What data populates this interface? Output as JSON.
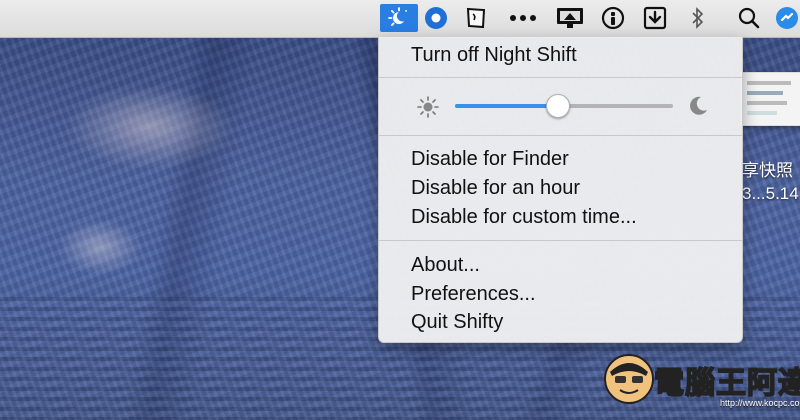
{
  "menubar": {
    "icons": [
      "shifty-icon",
      "blue-circle-icon",
      "script-icon",
      "more-icon",
      "display-icon",
      "info-icon",
      "download-icon",
      "bluetooth-icon",
      "search-icon",
      "notification-icon"
    ],
    "active_color": "#2a7de1"
  },
  "menu": {
    "items_top": [
      "Turn off Night Shift"
    ],
    "slider": {
      "value": 0.47,
      "min_icon": "sun-icon",
      "max_icon": "moon-icon",
      "fill_color": "#3b8ff0"
    },
    "items_disable": [
      "Disable for Finder",
      "Disable for an hour",
      "Disable for custom time..."
    ],
    "items_app": [
      "About...",
      "Preferences...",
      "Quit Shifty"
    ]
  },
  "desktop": {
    "preview_text_1": "享快照",
    "preview_text_2": "3...5.14"
  },
  "watermark": {
    "text": "電腦王阿達",
    "url": "http://www.kocpc.com.tw"
  }
}
